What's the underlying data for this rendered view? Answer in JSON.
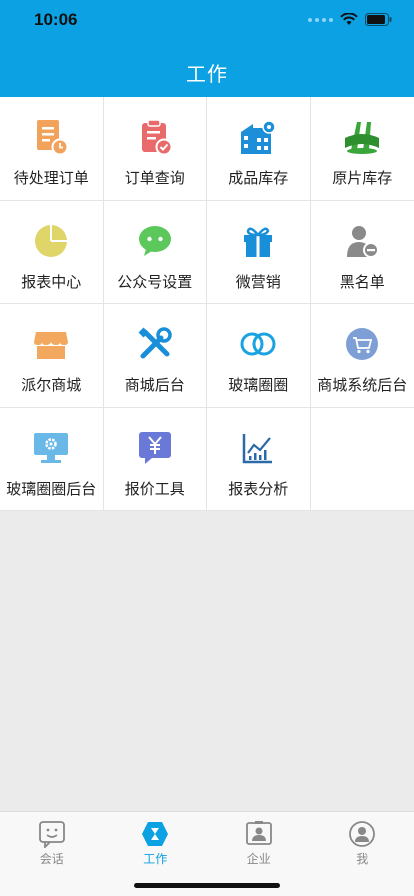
{
  "status": {
    "time": "10:06"
  },
  "header": {
    "title": "工作"
  },
  "grid": {
    "items": [
      {
        "label": "待处理订单",
        "icon": "pending-order-icon"
      },
      {
        "label": "订单查询",
        "icon": "order-query-icon"
      },
      {
        "label": "成品库存",
        "icon": "finished-goods-icon"
      },
      {
        "label": "原片库存",
        "icon": "raw-stock-icon"
      },
      {
        "label": "报表中心",
        "icon": "pie-chart-icon"
      },
      {
        "label": "公众号设置",
        "icon": "wechat-icon"
      },
      {
        "label": "微营销",
        "icon": "gift-icon"
      },
      {
        "label": "黑名单",
        "icon": "blacklist-icon"
      },
      {
        "label": "派尔商城",
        "icon": "shop-icon"
      },
      {
        "label": "商城后台",
        "icon": "tools-icon"
      },
      {
        "label": "玻璃圈圈",
        "icon": "rings-icon"
      },
      {
        "label": "商城系统后台",
        "icon": "cart-icon"
      },
      {
        "label": "玻璃圈圈后台",
        "icon": "monitor-gear-icon"
      },
      {
        "label": "报价工具",
        "icon": "yen-message-icon"
      },
      {
        "label": "报表分析",
        "icon": "line-chart-icon"
      }
    ]
  },
  "tabbar": {
    "tabs": [
      {
        "label": "会话",
        "icon": "chat-face-icon"
      },
      {
        "label": "工作",
        "icon": "hourglass-icon"
      },
      {
        "label": "企业",
        "icon": "contact-card-icon"
      },
      {
        "label": "我",
        "icon": "user-icon"
      }
    ],
    "active_index": 1
  },
  "colors": {
    "accent": "#0ba1e2"
  }
}
